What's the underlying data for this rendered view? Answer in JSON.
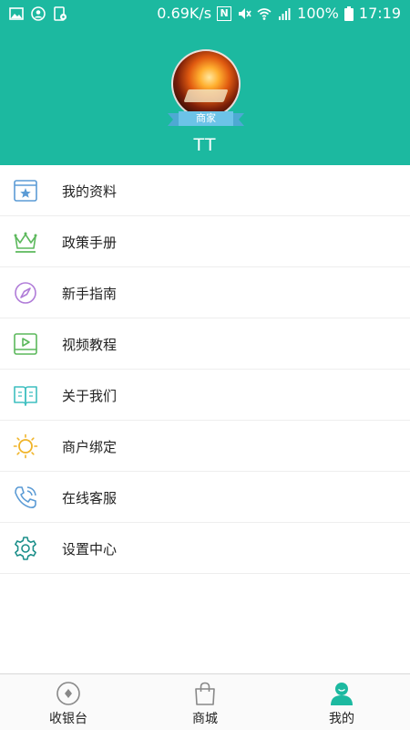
{
  "status_bar": {
    "network_speed": "0.69K/s",
    "nfc_label": "N",
    "battery": "100%",
    "time": "17:19"
  },
  "profile": {
    "badge": "商家",
    "username": "TT",
    "accent_color": "#1cb9a0"
  },
  "menu": {
    "items": [
      {
        "label": "我的资料",
        "icon": "profile-card-icon"
      },
      {
        "label": "政策手册",
        "icon": "crown-icon"
      },
      {
        "label": "新手指南",
        "icon": "compass-icon"
      },
      {
        "label": "视频教程",
        "icon": "video-play-icon"
      },
      {
        "label": "关于我们",
        "icon": "book-icon"
      },
      {
        "label": "商户绑定",
        "icon": "sun-icon"
      },
      {
        "label": "在线客服",
        "icon": "phone-icon"
      },
      {
        "label": "设置中心",
        "icon": "gear-icon"
      }
    ]
  },
  "bottom_nav": {
    "items": [
      {
        "label": "收银台",
        "icon": "cashier-icon",
        "active": false
      },
      {
        "label": "商城",
        "icon": "shopping-bag-icon",
        "active": false
      },
      {
        "label": "我的",
        "icon": "user-icon",
        "active": true
      }
    ]
  }
}
